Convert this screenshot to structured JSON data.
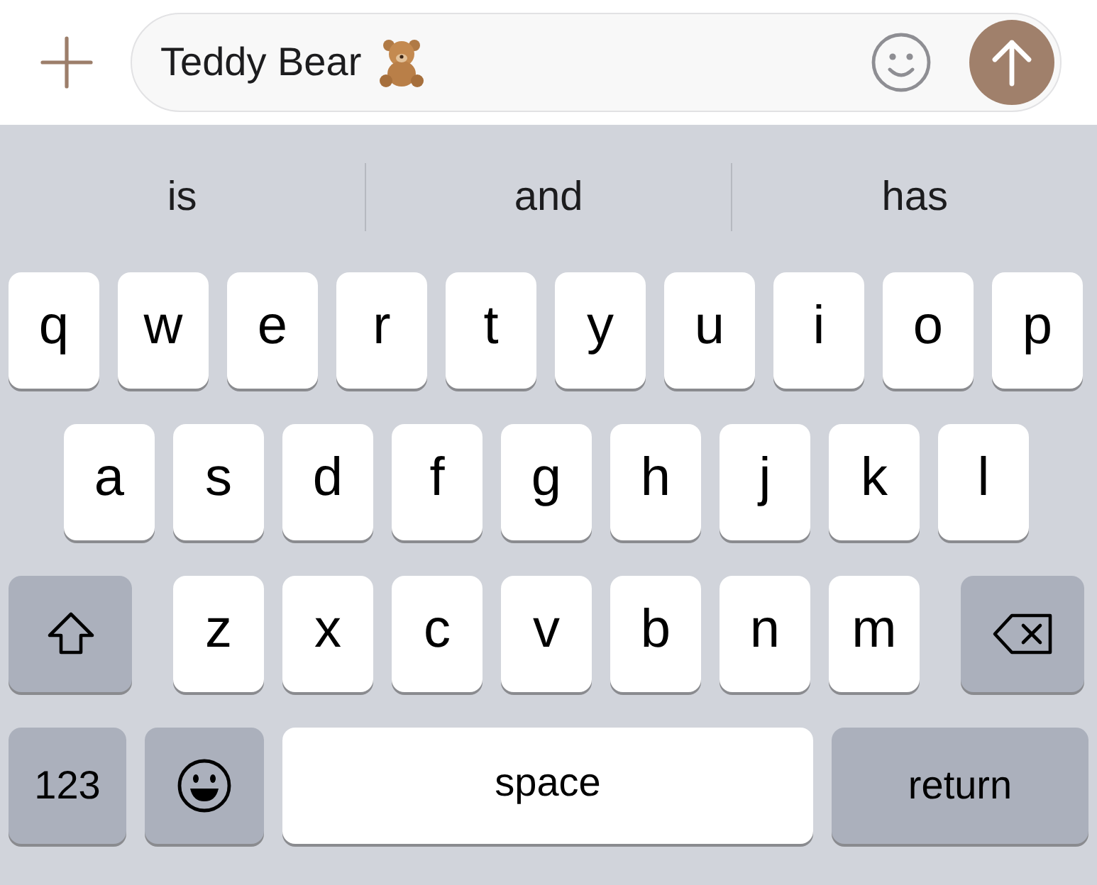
{
  "compose": {
    "value": "Teddy Bear"
  },
  "suggestions": [
    "is",
    "and",
    "has"
  ],
  "keyboard": {
    "key_rows": [
      {
        "keys": [
          {
            "kind": "letter",
            "label": "q"
          },
          {
            "kind": "letter",
            "label": "w"
          },
          {
            "kind": "letter",
            "label": "e"
          },
          {
            "kind": "letter",
            "label": "r"
          },
          {
            "kind": "letter",
            "label": "t"
          },
          {
            "kind": "letter",
            "label": "y"
          },
          {
            "kind": "letter",
            "label": "u"
          },
          {
            "kind": "letter",
            "label": "i"
          },
          {
            "kind": "letter",
            "label": "o"
          },
          {
            "kind": "letter",
            "label": "p"
          }
        ]
      },
      {
        "keys": [
          {
            "kind": "letter",
            "label": "a"
          },
          {
            "kind": "letter",
            "label": "s"
          },
          {
            "kind": "letter",
            "label": "d"
          },
          {
            "kind": "letter",
            "label": "f"
          },
          {
            "kind": "letter",
            "label": "g"
          },
          {
            "kind": "letter",
            "label": "h"
          },
          {
            "kind": "letter",
            "label": "j"
          },
          {
            "kind": "letter",
            "label": "k"
          },
          {
            "kind": "letter",
            "label": "l"
          }
        ]
      },
      {
        "keys": [
          {
            "kind": "shift",
            "on": false
          },
          {
            "kind": "letter",
            "label": "z"
          },
          {
            "kind": "letter",
            "label": "x"
          },
          {
            "kind": "letter",
            "label": "c"
          },
          {
            "kind": "letter",
            "label": "v"
          },
          {
            "kind": "letter",
            "label": "b"
          },
          {
            "kind": "letter",
            "label": "n"
          },
          {
            "kind": "letter",
            "label": "m"
          },
          {
            "kind": "delete"
          }
        ]
      },
      {
        "keys": [
          {
            "kind": "mode",
            "label": "123"
          },
          {
            "kind": "emoji"
          },
          {
            "kind": "space",
            "label": "space"
          },
          {
            "kind": "return",
            "label": "return"
          }
        ]
      }
    ]
  }
}
